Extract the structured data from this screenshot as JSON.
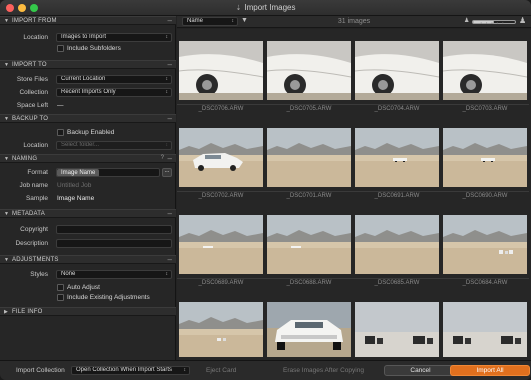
{
  "window": {
    "title": "Import Images"
  },
  "toolbar": {
    "sort_value": "Name",
    "image_count": "31 images",
    "zoom_level": 0.5,
    "icons": [
      "sort-direction-icon",
      "person-small-icon",
      "zoom-slider",
      "person-large-icon"
    ]
  },
  "sidebar": {
    "import_from": {
      "title": "IMPORT FROM",
      "location_label": "Location",
      "location_value": "Images to Import",
      "include_subfolders_label": "Include Subfolders",
      "include_subfolders": false
    },
    "import_to": {
      "title": "IMPORT TO",
      "store_files_label": "Store Files",
      "store_files_value": "Current Location",
      "collection_label": "Collection",
      "collection_value": "Recent Imports Only",
      "space_left_label": "Space Left",
      "space_left_value": "—"
    },
    "backup_to": {
      "title": "BACKUP TO",
      "backup_enabled_label": "Backup Enabled",
      "backup_enabled": false,
      "location_label": "Location",
      "location_placeholder": "Select folder..."
    },
    "naming": {
      "title": "NAMING",
      "help": "?",
      "format_label": "Format",
      "format_token": "Image Name",
      "format_more": "...",
      "job_name_label": "Job name",
      "job_name_placeholder": "Untitled Job",
      "sample_label": "Sample",
      "sample_value": "Image Name"
    },
    "metadata": {
      "title": "METADATA",
      "copyright_label": "Copyright",
      "description_label": "Description"
    },
    "adjustments": {
      "title": "ADJUSTMENTS",
      "styles_label": "Styles",
      "styles_value": "None",
      "auto_adjust_label": "Auto Adjust",
      "auto_adjust": false,
      "include_existing_label": "Include Existing Adjustments",
      "include_existing": false
    },
    "file_info": {
      "title": "FILE INFO"
    }
  },
  "bottom": {
    "import_collection_label": "Import Collection",
    "import_collection_value": "Open Collection When Import Starts",
    "eject_card": "Eject Card",
    "erase_images": "Erase Images After Copying",
    "cancel_label": "Cancel",
    "import_label": "Import All"
  },
  "images": [
    {
      "name": "_DSC0706.ARW",
      "scene": "car-closeup"
    },
    {
      "name": "_DSC0705.ARW",
      "scene": "car-closeup"
    },
    {
      "name": "_DSC0704.ARW",
      "scene": "car-closeup"
    },
    {
      "name": "_DSC0703.ARW",
      "scene": "car-closeup"
    },
    {
      "name": "_DSC0702.ARW",
      "scene": "car-desert"
    },
    {
      "name": "_DSC0701.ARW",
      "scene": "desert-mountains"
    },
    {
      "name": "_DSC0691.ARW",
      "scene": "desert-car-small"
    },
    {
      "name": "_DSC0690.ARW",
      "scene": "desert-car-small"
    },
    {
      "name": "_DSC0689.ARW",
      "scene": "desert-car-far"
    },
    {
      "name": "_DSC0688.ARW",
      "scene": "desert-car-far"
    },
    {
      "name": "_DSC0685.ARW",
      "scene": "desert-plain"
    },
    {
      "name": "_DSC0684.ARW",
      "scene": "desert-gear"
    },
    {
      "name": "",
      "scene": "desert-gear-low"
    },
    {
      "name": "",
      "scene": "car-front"
    },
    {
      "name": "",
      "scene": "gear-white"
    },
    {
      "name": "",
      "scene": "gear-white"
    }
  ]
}
